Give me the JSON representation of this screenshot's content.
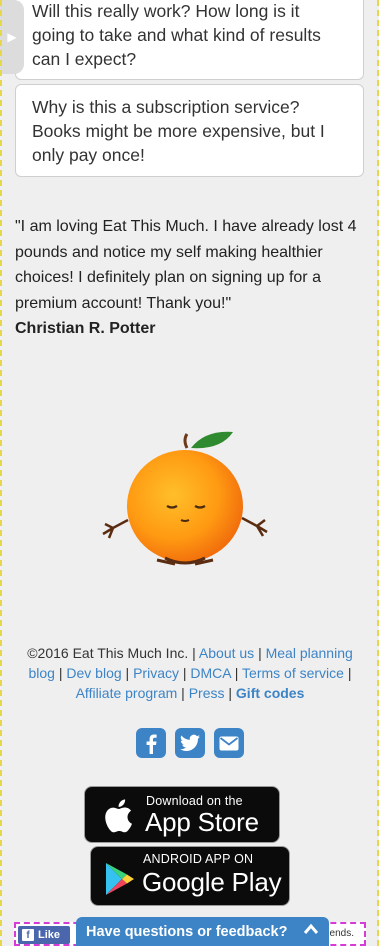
{
  "faq": [
    {
      "question": "Will this really work? How long is it going to take and what kind of results can I expect?"
    },
    {
      "question": "Why is this a subscription service? Books might be more expensive, but I only pay once!"
    }
  ],
  "testimonial": {
    "quote": "\"I am loving Eat This Much. I have already lost 4 pounds and notice my self making healthier choices! I definitely plan on signing up for a premium account! Thank you!\"",
    "author": "Christian R. Potter"
  },
  "footer": {
    "copyright": "©2016 Eat This Much Inc.",
    "links": {
      "about": "About us",
      "meal_blog": "Meal planning blog",
      "dev_blog": "Dev blog",
      "privacy": "Privacy",
      "dmca": "DMCA",
      "terms": "Terms of service",
      "affiliate": "Affiliate program",
      "press": "Press",
      "gift": "Gift codes"
    },
    "sep": "|"
  },
  "social": [
    "facebook-icon",
    "twitter-icon",
    "email-icon"
  ],
  "stores": {
    "apple_small": "Download on the",
    "apple_big": "App Store",
    "google_small": "ANDROID APP ON",
    "google_big": "Google Play"
  },
  "bottom": {
    "like_label": "Like",
    "feedback_label": "Have questions or feedback?",
    "friends_text": "ends."
  },
  "colors": {
    "link": "#3d84c6",
    "accent": "#3d84c6",
    "facebook": "#4a66ad"
  }
}
